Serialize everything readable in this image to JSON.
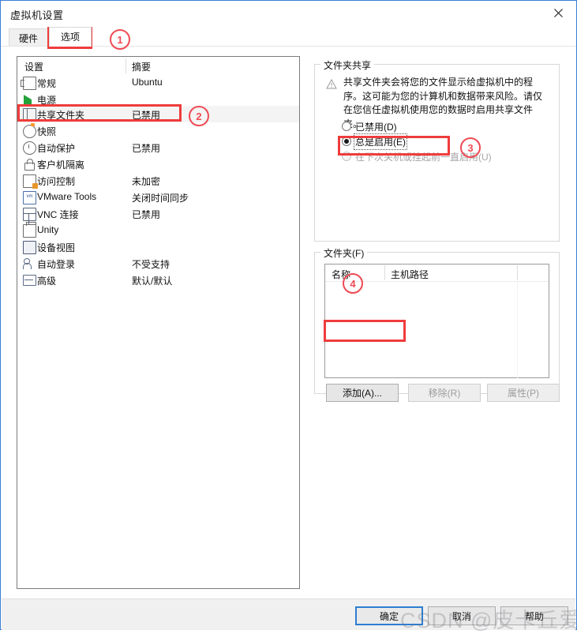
{
  "window": {
    "title": "虚拟机设置",
    "close_icon": "close-icon"
  },
  "tabs": [
    {
      "label": "硬件",
      "active": false
    },
    {
      "label": "选项",
      "active": true
    }
  ],
  "settings_list": {
    "headers": {
      "setting": "设置",
      "summary": "摘要"
    },
    "rows": [
      {
        "icon": "monitor-icon",
        "name": "常规",
        "summary": "Ubuntu",
        "selected": false
      },
      {
        "icon": "power-icon",
        "name": "电源",
        "summary": "",
        "selected": false
      },
      {
        "icon": "shared-folder-icon",
        "name": "共享文件夹",
        "summary": "已禁用",
        "selected": true
      },
      {
        "icon": "snapshot-icon",
        "name": "快照",
        "summary": "",
        "selected": false
      },
      {
        "icon": "autoprotect-icon",
        "name": "自动保护",
        "summary": "已禁用",
        "selected": false
      },
      {
        "icon": "guest-isolation-icon",
        "name": "客户机隔离",
        "summary": "",
        "selected": false
      },
      {
        "icon": "access-control-icon",
        "name": "访问控制",
        "summary": "未加密",
        "selected": false
      },
      {
        "icon": "vmware-tools-icon",
        "name": "VMware Tools",
        "summary": "关闭时间同步",
        "selected": false
      },
      {
        "icon": "vnc-icon",
        "name": "VNC 连接",
        "summary": "已禁用",
        "selected": false
      },
      {
        "icon": "unity-icon",
        "name": "Unity",
        "summary": "",
        "selected": false
      },
      {
        "icon": "device-view-icon",
        "name": "设备视图",
        "summary": "",
        "selected": false
      },
      {
        "icon": "autologin-icon",
        "name": "自动登录",
        "summary": "不受支持",
        "selected": false
      },
      {
        "icon": "advanced-icon",
        "name": "高级",
        "summary": "默认/默认",
        "selected": false
      }
    ]
  },
  "folder_sharing": {
    "group_label": "文件夹共享",
    "warning_icon": "warning-triangle-icon",
    "warning_text": "共享文件夹会将您的文件显示给虚拟机中的程序。这可能为您的计算机和数据带来风险。请仅在您信任虚拟机使用您的数据时启用共享文件夹。",
    "options": [
      {
        "label": "已禁用(D)",
        "selected": false,
        "disabled": false
      },
      {
        "label": "总是启用(E)",
        "selected": true,
        "disabled": false
      },
      {
        "label": "在下次关机或挂起前一直启用(U)",
        "selected": false,
        "disabled": true
      }
    ]
  },
  "folders": {
    "group_label": "文件夹(F)",
    "columns": [
      "名称",
      "主机路径",
      ""
    ],
    "rows": [],
    "buttons": [
      {
        "label": "添加(A)...",
        "disabled": false
      },
      {
        "label": "移除(R)",
        "disabled": true
      },
      {
        "label": "属性(P)",
        "disabled": true
      }
    ]
  },
  "footer": {
    "ok_label": "确定",
    "cancel_label": "取消",
    "help_label": "帮助"
  },
  "annotations": {
    "color": "#ef4a54",
    "markers": [
      "①",
      "②",
      "③",
      "④"
    ],
    "numbers": [
      "1",
      "2",
      "3",
      "4"
    ]
  },
  "watermark": {
    "text": "CSDN @皮卡丘爱摆烂"
  }
}
